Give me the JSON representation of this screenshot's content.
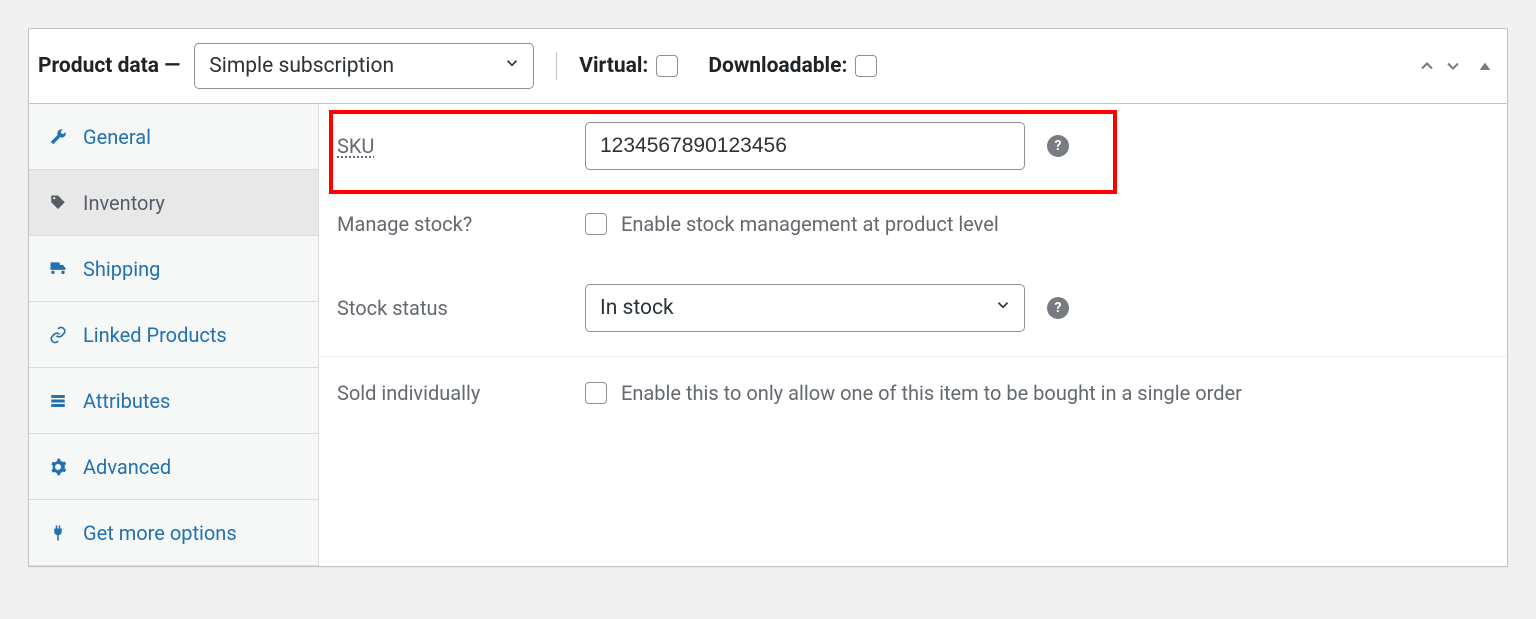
{
  "header": {
    "title_prefix": "Product data",
    "dash": "—",
    "product_type": "Simple subscription",
    "virtual_label": "Virtual:",
    "downloadable_label": "Downloadable:"
  },
  "tabs": {
    "general": "General",
    "inventory": "Inventory",
    "shipping": "Shipping",
    "linked": "Linked Products",
    "attributes": "Attributes",
    "advanced": "Advanced",
    "more": "Get more options"
  },
  "inventory": {
    "sku_label": "SKU",
    "sku_value": "1234567890123456",
    "manage_stock_label": "Manage stock?",
    "manage_stock_desc": "Enable stock management at product level",
    "stock_status_label": "Stock status",
    "stock_status_value": "In stock",
    "sold_individually_label": "Sold individually",
    "sold_individually_desc": "Enable this to only allow one of this item to be bought in a single order"
  }
}
